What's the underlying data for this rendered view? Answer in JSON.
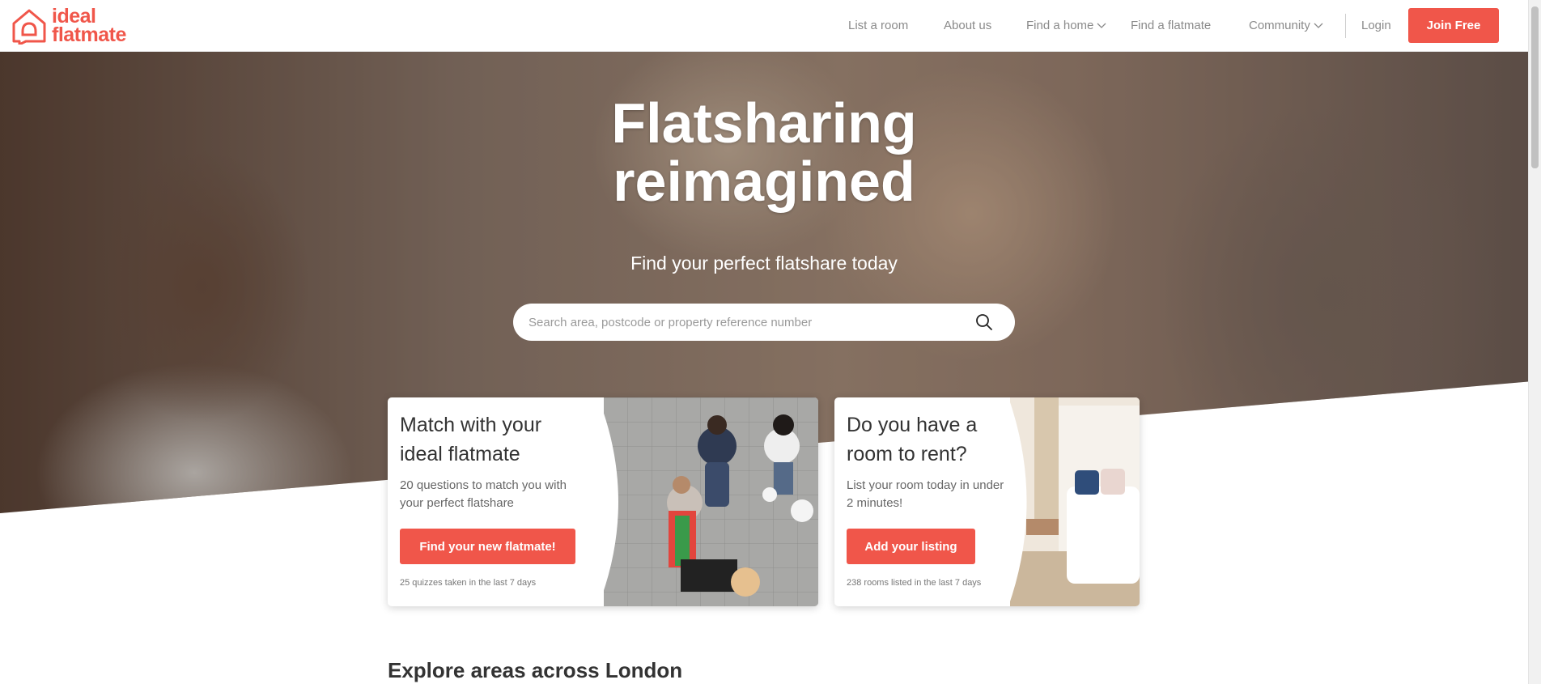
{
  "brand": {
    "line1": "ideal",
    "line2": "flatmate",
    "color": "#f0564a"
  },
  "nav": {
    "items": [
      {
        "label": "List a room"
      },
      {
        "label": "About us"
      },
      {
        "label": "Find a home"
      },
      {
        "label": "Find a flatmate"
      },
      {
        "label": "Community"
      }
    ],
    "login": "Login",
    "join": "Join Free"
  },
  "hero": {
    "title_line1": "Flatsharing",
    "title_line2": "reimagined",
    "subtitle": "Find your perfect flatshare today",
    "search_placeholder": "Search area, postcode or property reference number",
    "search_icon": "search-icon"
  },
  "cards": [
    {
      "title_line1": "Match with your",
      "title_line2": "ideal flatmate",
      "desc_line1": "20 questions to match you with",
      "desc_line2": "your perfect flatshare",
      "button": "Find your new flatmate!",
      "meta": "25 quizzes taken in the last 7 days"
    },
    {
      "title_line1": "Do you have a",
      "title_line2": "room to rent?",
      "desc_line1": "List your room today in under",
      "desc_line2": "2 minutes!",
      "button": "Add your listing",
      "meta": "238 rooms listed in the last 7 days"
    }
  ],
  "explore": {
    "heading": "Explore areas across London"
  }
}
